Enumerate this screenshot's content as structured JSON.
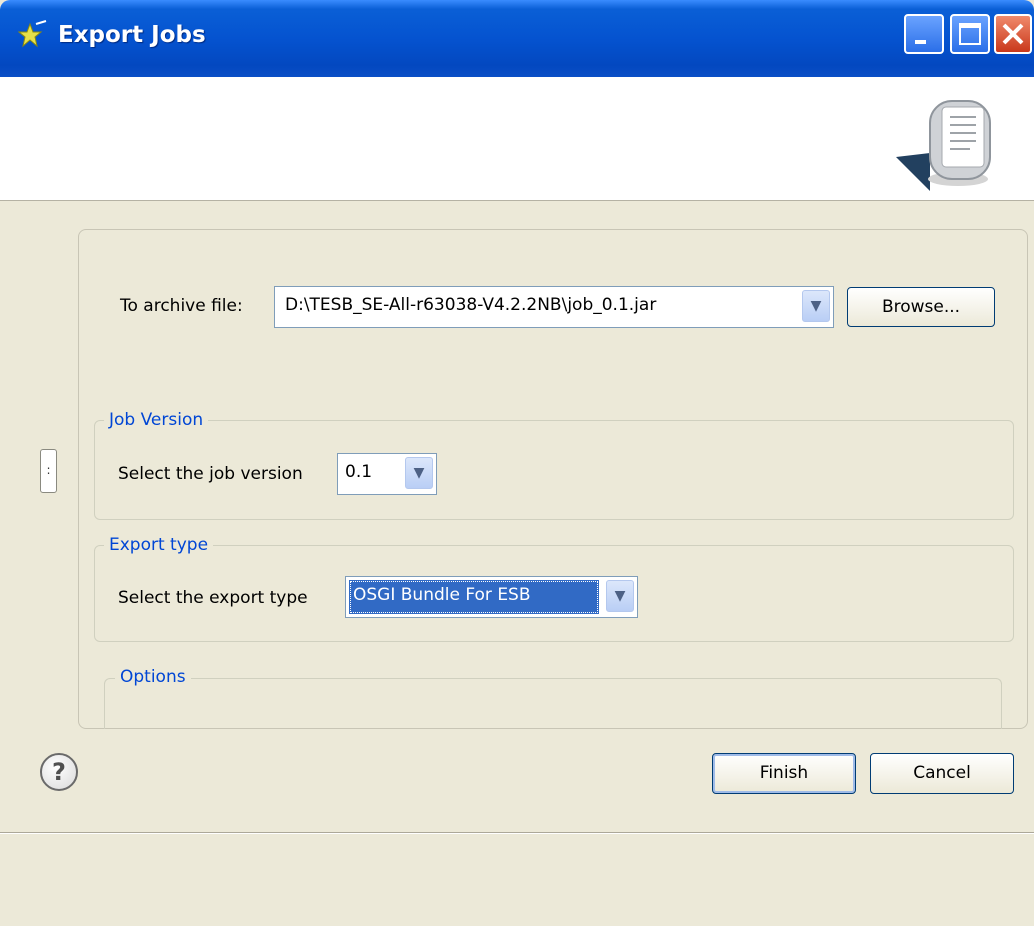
{
  "window": {
    "title": "Export Jobs"
  },
  "archive": {
    "label": "To archive file:",
    "value": "D:\\TESB_SE-All-r63038-V4.2.2NB\\job_0.1.jar",
    "browse_label": "Browse..."
  },
  "job_version": {
    "legend": "Job Version",
    "label": "Select the job version",
    "value": "0.1"
  },
  "export_type": {
    "legend": "Export type",
    "label": "Select the export type",
    "value": "OSGI Bundle For ESB"
  },
  "options": {
    "legend": "Options"
  },
  "footer": {
    "help_glyph": "?",
    "finish_label": "Finish",
    "cancel_label": "Cancel"
  },
  "colors": {
    "titlebar": "#0553d0",
    "legend_text": "#0046d5",
    "selection": "#316ac5",
    "window_bg": "#ece9d8"
  },
  "icons": [
    "wizard-icon",
    "minimize-icon",
    "maximize-icon",
    "close-icon",
    "export-banner-icon",
    "chevron-down-icon",
    "help-icon"
  ]
}
